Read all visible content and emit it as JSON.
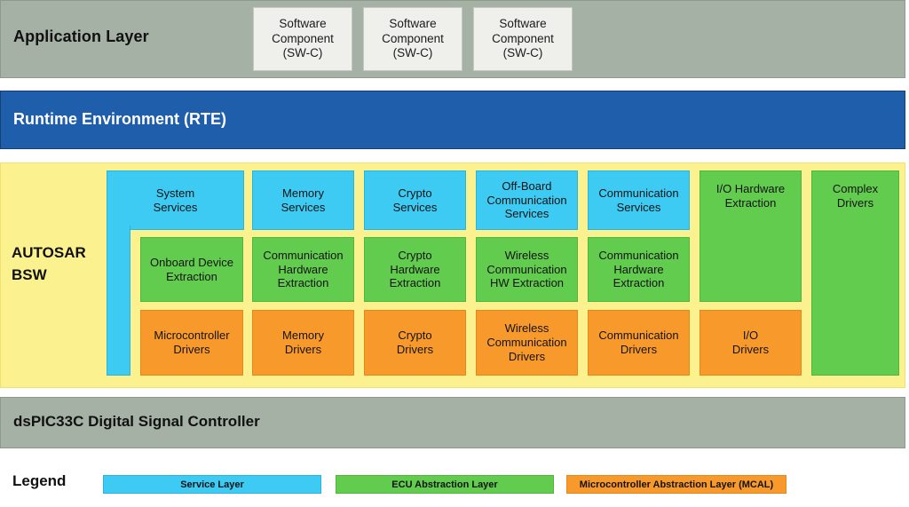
{
  "colors": {
    "band_gray": "#a6b1a6",
    "band_blue": "#1f5eab",
    "band_yellow": "#fbf18f",
    "service_layer": "#3ecbf3",
    "ecu_abstraction": "#62cc4f",
    "mcal": "#f89a2b",
    "swc_box": "#eff0ec"
  },
  "application_layer": {
    "title": "Application Layer",
    "components": [
      {
        "label": "Software\nComponent\n(SW-C)"
      },
      {
        "label": "Software\nComponent\n(SW-C)"
      },
      {
        "label": "Software\nComponent\n(SW-C)"
      }
    ]
  },
  "rte": {
    "title": "Runtime Environment (RTE)"
  },
  "bsw": {
    "title": "AUTOSAR\nBSW",
    "service_layer": [
      {
        "label": "System\nServices"
      },
      {
        "label": "Memory\nServices"
      },
      {
        "label": "Crypto\nServices"
      },
      {
        "label": "Off-Board\nCommunication\nServices"
      },
      {
        "label": "Communication\nServices"
      }
    ],
    "ecu_abstraction_layer": [
      {
        "label": "Onboard Device\nExtraction"
      },
      {
        "label": "Communication\nHardware\nExtraction"
      },
      {
        "label": "Crypto\nHardware\nExtraction"
      },
      {
        "label": "Wireless\nCommunication\nHW Extraction"
      },
      {
        "label": "Communication\nHardware\nExtraction"
      },
      {
        "label": "I/O Hardware\nExtraction"
      }
    ],
    "mcal_layer": [
      {
        "label": "Microcontroller\nDrivers"
      },
      {
        "label": "Memory\nDrivers"
      },
      {
        "label": "Crypto\nDrivers"
      },
      {
        "label": "Wireless\nCommunication\nDrivers"
      },
      {
        "label": "Communication\nDrivers"
      },
      {
        "label": "I/O\nDrivers"
      }
    ],
    "complex_drivers": {
      "label": "Complex\nDrivers"
    }
  },
  "microcontroller": {
    "title": "dsPIC33C Digital Signal Controller"
  },
  "legend": {
    "title": "Legend",
    "items": [
      {
        "label": "Service Layer",
        "color": "#3ecbf3"
      },
      {
        "label": "ECU Abstraction Layer",
        "color": "#62cc4f"
      },
      {
        "label": "Microcontroller Abstraction Layer (MCAL)",
        "color": "#f89a2b"
      }
    ]
  }
}
